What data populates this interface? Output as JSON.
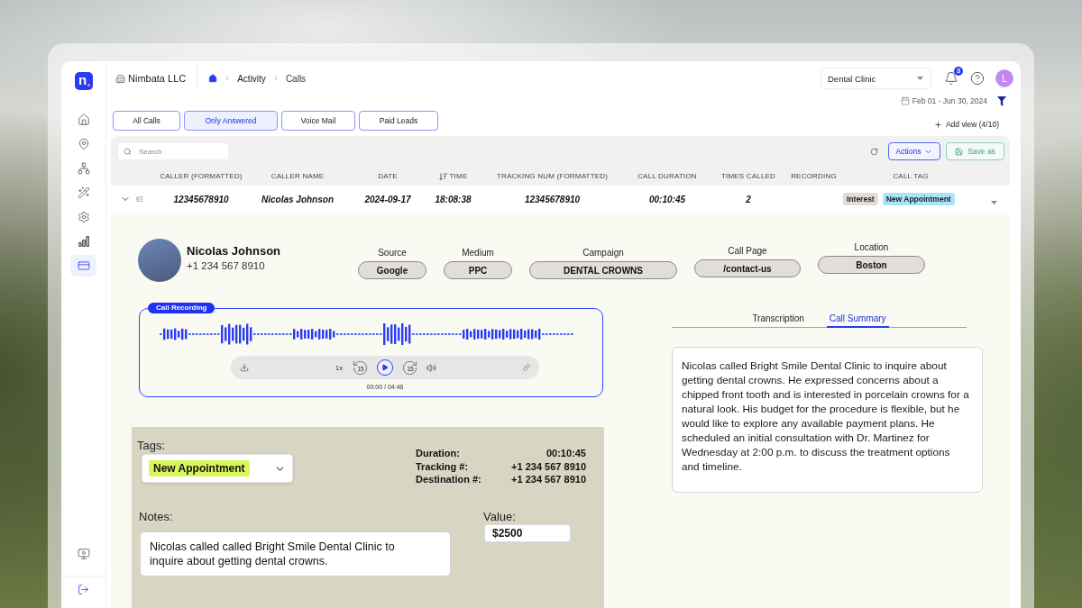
{
  "logo": "n",
  "workspace": {
    "name": "Nimbata LLC"
  },
  "breadcrumb": [
    "Activity",
    "Calls"
  ],
  "account_select": {
    "value": "Dental Clinic"
  },
  "notifications": {
    "count": "3"
  },
  "user": {
    "initial": "L"
  },
  "date_range": "Feb 01 - Jun 30, 2024",
  "sidebar": {
    "items": [
      {
        "selected": false
      },
      {
        "selected": false
      },
      {
        "selected": false
      },
      {
        "selected": false
      },
      {
        "selected": false
      },
      {
        "selected": false
      },
      {
        "selected": true
      }
    ]
  },
  "tabs": [
    {
      "label": "All Calls",
      "selected": false
    },
    {
      "label": "Only Answered",
      "selected": true
    },
    {
      "label": "Voice Mail",
      "selected": false
    },
    {
      "label": "Paid Leads",
      "selected": false
    }
  ],
  "add_view": "Add view (4/10)",
  "toolbar": {
    "search": {
      "placeholder": "Search"
    },
    "actions": "Actions",
    "save": "Save as"
  },
  "table": {
    "columns": [
      {
        "label": "CALLER (FORMATTED)",
        "sorted": false
      },
      {
        "label": "CALLER NAME",
        "sorted": false
      },
      {
        "label": "DATE",
        "sorted": false
      },
      {
        "label": "TIME",
        "sorted": true
      },
      {
        "label": "TRACKING NUM (FORMATTED)",
        "sorted": false
      },
      {
        "label": "CALL DURATION",
        "sorted": false
      },
      {
        "label": "TIMES CALLED",
        "sorted": false
      },
      {
        "label": "RECORDING",
        "sorted": false
      },
      {
        "label": "CALL TAG",
        "sorted": false
      }
    ],
    "rows": [
      {
        "expanded": true,
        "cells": [
          "12345678910",
          "Nicolas Johnson",
          "2024-09-17",
          "18:08:38",
          "12345678910",
          "00:10:45",
          "2"
        ],
        "tags": [
          {
            "label": "Interest",
            "color": "#e2dcd8"
          },
          {
            "label": "New Appointment",
            "color": "#a9e5f8"
          }
        ]
      }
    ]
  },
  "call_detail": {
    "contact": {
      "name": "Nicolas Johnson",
      "phone": "+1 234 567 8910"
    },
    "attributes": [
      {
        "label": "Source",
        "value": "Google"
      },
      {
        "label": "Medium",
        "value": "PPC"
      },
      {
        "label": "Campaign",
        "value": "DENTAL CROWNS"
      },
      {
        "label": "Call Page",
        "value": "/contact-us"
      },
      {
        "label": "Location",
        "value": "Boston"
      }
    ],
    "recording": {
      "title": "Call Recording",
      "speed": "1x",
      "rewind": "15",
      "forward": "15",
      "time": "00:00 / 04:46"
    },
    "summary_tabs": [
      {
        "label": "Transcription",
        "selected": false
      },
      {
        "label": "Call Summary",
        "selected": true
      }
    ],
    "summary": "Nicolas called Bright Smile Dental Clinic to inquire about getting dental crowns. He expressed concerns about a chipped front tooth and is interested in porcelain crowns for a natural look. His budget for the procedure is flexible, but he would like to explore any available payment plans. He scheduled an initial consultation with Dr. Martinez for Wednesday at 2:00 p.m. to discuss the treatment options and timeline.",
    "tags": {
      "label": "Tags:",
      "value": "New Appointment"
    },
    "stats": [
      {
        "label": "Duration:",
        "value": "00:10:45"
      },
      {
        "label": "Tracking #:",
        "value": "+1 234 567 8910"
      },
      {
        "label": "Destination #:",
        "value": "+1 234 567 8910"
      }
    ],
    "notes": {
      "label": "Notes:",
      "value": "Nicolas called called Bright Smile Dental Clinic to inquire about getting dental crowns."
    },
    "value": {
      "label": "Value:",
      "value": "$2500"
    }
  }
}
